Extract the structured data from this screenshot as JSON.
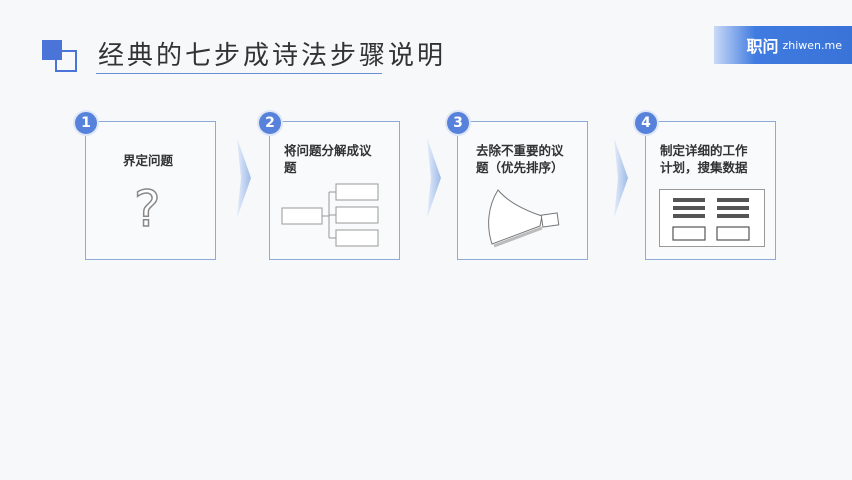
{
  "header": {
    "title": "经典的七步成诗法步骤说明"
  },
  "brand": {
    "cn": "职问",
    "en": "zhiwen.me"
  },
  "steps": [
    {
      "num": "1",
      "label": "界定问题"
    },
    {
      "num": "2",
      "line1": "将问题分解成议",
      "line2": "题"
    },
    {
      "num": "3",
      "line1": "去除不重要的议",
      "line2": "题（优先排序）"
    },
    {
      "num": "4",
      "line1": "制定详细的工作",
      "line2": "计划，搜集数据"
    }
  ],
  "colors": {
    "accent": "#4b74d8",
    "card_border": "#8eaad6",
    "number_badge": "#5782db",
    "brand_bg": "#3a73d8"
  },
  "icons": [
    "question-mark-icon",
    "issue-tree-icon",
    "funnel-icon",
    "work-plan-icon",
    "chevron-arrow-icon"
  ]
}
